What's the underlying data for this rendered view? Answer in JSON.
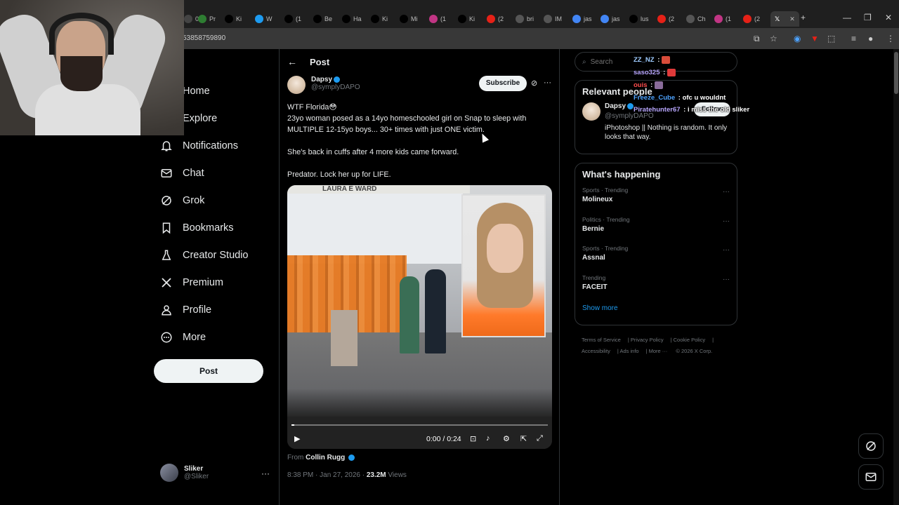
{
  "browser": {
    "tabs": [
      {
        "label": "0",
        "fav_color": "#444"
      },
      {
        "label": "Pr",
        "fav_color": "#2e7d32"
      },
      {
        "label": "Ki",
        "fav_color": "#000"
      },
      {
        "label": "W",
        "fav_color": "#1d9bf0"
      },
      {
        "label": "(1",
        "fav_color": "#000"
      },
      {
        "label": "Be",
        "fav_color": "#000"
      },
      {
        "label": "Ha",
        "fav_color": "#000"
      },
      {
        "label": "Ki",
        "fav_color": "#000"
      },
      {
        "label": "Mi",
        "fav_color": "#000"
      },
      {
        "label": "(1",
        "fav_color": "#c13584"
      },
      {
        "label": "Ki",
        "fav_color": "#000"
      },
      {
        "label": "(2",
        "fav_color": "#e62117"
      },
      {
        "label": "bri",
        "fav_color": "#555"
      },
      {
        "label": "IM",
        "fav_color": "#555"
      },
      {
        "label": "jas",
        "fav_color": "#4285f4"
      },
      {
        "label": "jas",
        "fav_color": "#4285f4"
      },
      {
        "label": "lus",
        "fav_color": "#000"
      },
      {
        "label": "(2",
        "fav_color": "#e62117"
      },
      {
        "label": "Ch",
        "fav_color": "#555"
      },
      {
        "label": "(1",
        "fav_color": "#c13584"
      },
      {
        "label": "(2",
        "fav_color": "#e62117"
      }
    ],
    "url": "53858759890",
    "new_tab": "+",
    "minimize": "—",
    "restore": "❐",
    "close": "✕"
  },
  "nav": {
    "items": [
      {
        "label": "Home",
        "icon": "home-icon"
      },
      {
        "label": "Explore",
        "icon": "search-icon"
      },
      {
        "label": "Notifications",
        "icon": "bell-icon"
      },
      {
        "label": "Chat",
        "icon": "mail-icon"
      },
      {
        "label": "Grok",
        "icon": "grok-icon"
      },
      {
        "label": "Bookmarks",
        "icon": "bookmark-icon"
      },
      {
        "label": "Creator Studio",
        "icon": "flask-icon"
      },
      {
        "label": "Premium",
        "icon": "x-logo-icon"
      },
      {
        "label": "Profile",
        "icon": "person-icon"
      },
      {
        "label": "More",
        "icon": "more-circle-icon"
      }
    ],
    "post_button": "Post",
    "account": {
      "name": "Sliker",
      "handle": "@Sliker"
    }
  },
  "post": {
    "title": "Post",
    "author": {
      "name": "Dapsy",
      "handle": "@symplyDAPO"
    },
    "subscribe": "Subscribe",
    "text": [
      "WTF Florida😳",
      "23yo woman posed as a 14yo homeschooled girl on Snap to sleep with MULTIPLE 12-15yo boys... 30+ times with just ONE victim.",
      "She's back in cuffs after 4 more kids came forward.",
      "Predator. Lock her up for LIFE."
    ],
    "media": {
      "court_sign": "LAURA E WARD",
      "time": "0:00 / 0:24",
      "progress": 0.01
    },
    "from_label": "From",
    "from_name": "Collin Rugg",
    "timestamp": "8:38 PM · Jan 27, 2026 · ",
    "views_count": "23.2M",
    "views_label": " Views"
  },
  "sidebar": {
    "search_placeholder": "Search",
    "relevant": {
      "title": "Relevant people",
      "name": "Dapsy",
      "handle": "@symplyDAPO",
      "follow": "Follow",
      "bio": "iPhotoshop || Nothing is random. It only looks that way."
    },
    "happening": {
      "title": "What's happening",
      "trends": [
        {
          "category": "Sports · Trending",
          "name": "Molineux"
        },
        {
          "category": "Politics · Trending",
          "name": "Bernie"
        },
        {
          "category": "Sports · Trending",
          "name": "Assnal"
        },
        {
          "category": "Trending",
          "name": "FACEIT"
        }
      ],
      "show_more": "Show more"
    },
    "footer": [
      "Terms of Service",
      "Privacy Policy",
      "Cookie Policy",
      "Accessibility",
      "Ads info",
      "More ···",
      "© 2026 X Corp."
    ]
  },
  "chat": [
    {
      "user": "ZZ_NZ",
      "sep": " :",
      "msg": "",
      "color": "#9ecbff"
    },
    {
      "user": "saso325",
      "sep": " :",
      "msg": "",
      "color": "#b9a7ff"
    },
    {
      "user": "ouis",
      "sep": " :",
      "msg": "",
      "color": "#ff4d4d"
    },
    {
      "user": "Freeze_Cube",
      "sep": " :",
      "msg": " ofc u wouldnt",
      "color": "#4da3ff"
    },
    {
      "user": "Piratehunter67",
      "sep": " :",
      "msg": " i miss the old sliker",
      "color": "#b9a7ff"
    }
  ]
}
